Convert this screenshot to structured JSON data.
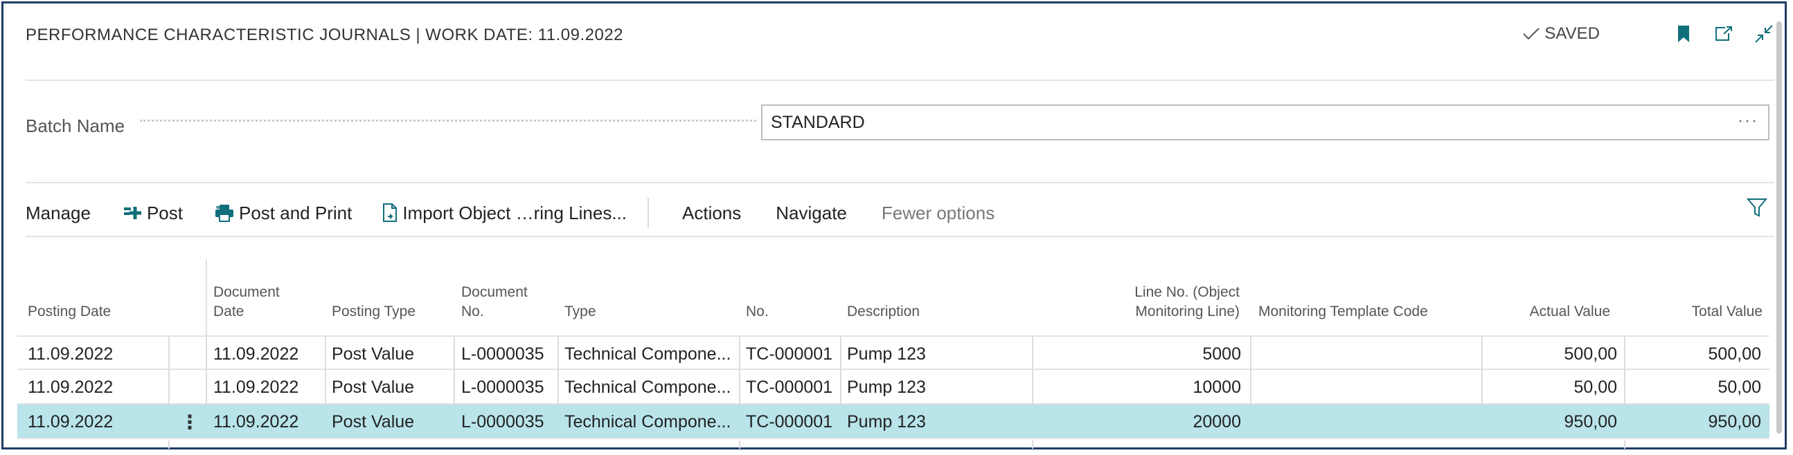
{
  "header": {
    "title": "PERFORMANCE CHARACTERISTIC JOURNALS | WORK DATE: 11.09.2022",
    "saved_label": "SAVED"
  },
  "batch": {
    "label": "Batch Name",
    "value": "STANDARD",
    "more": "···"
  },
  "actions": {
    "manage": "Manage",
    "post": "Post",
    "post_and_print": "Post and Print",
    "import": "Import Object …ring Lines...",
    "actions": "Actions",
    "navigate": "Navigate",
    "fewer": "Fewer options"
  },
  "columns": {
    "posting_date": "Posting Date",
    "document_date_1": "Document",
    "document_date_2": "Date",
    "posting_type": "Posting Type",
    "document_no_1": "Document",
    "document_no_2": "No.",
    "type": "Type",
    "no": "No.",
    "description": "Description",
    "line_no_1": "Line No. (Object",
    "line_no_2": "Monitoring Line)",
    "template": "Monitoring Template Code",
    "actual": "Actual Value",
    "total": "Total Value"
  },
  "rows": [
    {
      "posting_date": "11.09.2022",
      "document_date": "11.09.2022",
      "posting_type": "Post Value",
      "document_no": "L-0000035",
      "type": "Technical Compone...",
      "no": "TC-000001",
      "description": "Pump 123",
      "line_no": "5000",
      "template": "",
      "actual": "500,00",
      "total": "500,00"
    },
    {
      "posting_date": "11.09.2022",
      "document_date": "11.09.2022",
      "posting_type": "Post Value",
      "document_no": "L-0000035",
      "type": "Technical Compone...",
      "no": "TC-000001",
      "description": "Pump 123",
      "line_no": "10000",
      "template": "",
      "actual": "50,00",
      "total": "50,00"
    },
    {
      "posting_date": "11.09.2022",
      "document_date": "11.09.2022",
      "posting_type": "Post Value",
      "document_no": "L-0000035",
      "type": "Technical Compone...",
      "no": "TC-000001",
      "description": "Pump 123",
      "line_no": "20000",
      "template": "",
      "actual": "950,00",
      "total": "950,00",
      "context_menu": "⋮"
    }
  ],
  "colors": {
    "selected_row": "#b8e4ea",
    "accent": "#0f6f7a",
    "frame": "#1f3b63"
  }
}
